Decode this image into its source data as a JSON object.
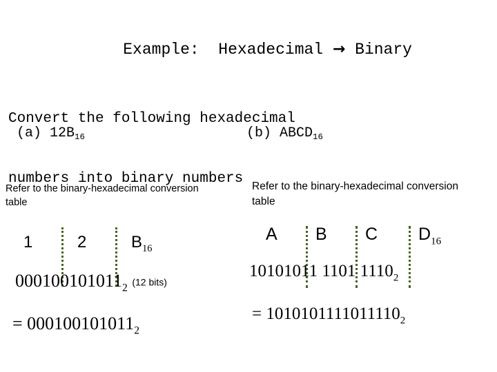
{
  "slide": {
    "background_color": "#ffffff",
    "text_color": "#000000",
    "separator_color": "#44661a"
  },
  "title": {
    "prefix": "Example:  Hexadecimal ",
    "arrow_icon": "right-arrow",
    "arrow_glyph": "→",
    "suffix": " Binary",
    "full": "Example:  Hexadecimal → Binary"
  },
  "question": {
    "line1": "Convert the following hexadecimal",
    "line2": "numbers into binary numbers"
  },
  "parts": {
    "a": {
      "label": "(a)",
      "value": "12B",
      "base": "16"
    },
    "b": {
      "label": "(b)",
      "value": "ABCD",
      "base": "16"
    }
  },
  "note": {
    "line1": "Refer to the binary-hexadecimal",
    "line2": "conversion table"
  },
  "left_column": {
    "hex_digits": [
      "1",
      "2",
      "B"
    ],
    "hex_base": "16",
    "binary_groups": [
      "0001",
      "0010",
      "1011"
    ],
    "binary_base": "2",
    "bits_note": "(12 bits)",
    "result_prefix": "= ",
    "result": "000100101011",
    "result_base": "2"
  },
  "right_column": {
    "hex_digits": [
      "A",
      "B",
      "C",
      "D"
    ],
    "hex_base": "16",
    "binary_groups": [
      "1010",
      "1011",
      "1101",
      "1110"
    ],
    "binary_base": "2",
    "result_prefix": "= ",
    "result": "1010101111011110",
    "result_base": "2"
  }
}
